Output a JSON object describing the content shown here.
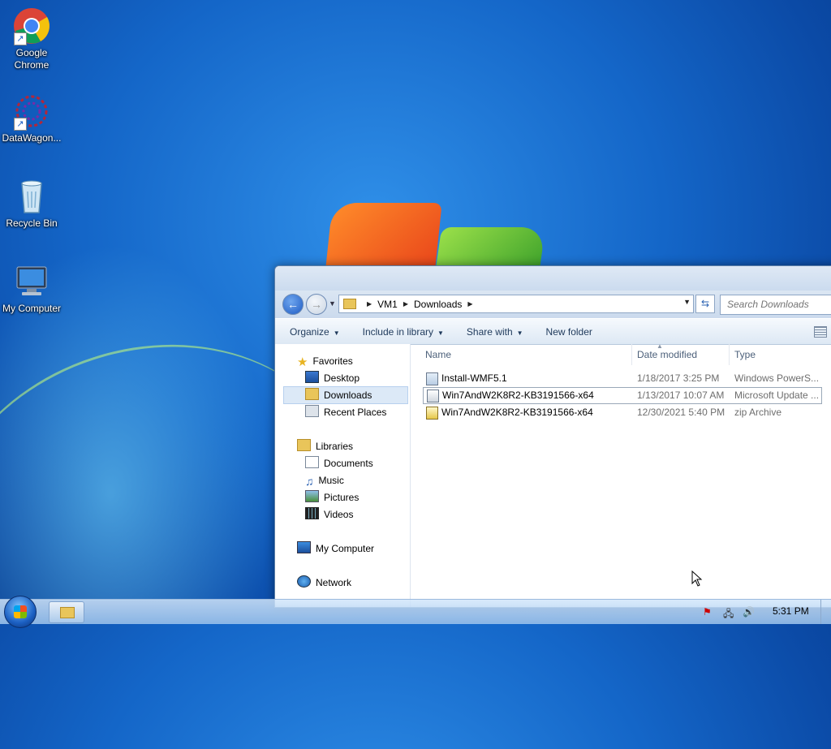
{
  "desktop": {
    "icons": [
      {
        "label": "Google Chrome",
        "icon": "chrome-icon"
      },
      {
        "label": "DataWagon...",
        "icon": "datawagon-icon"
      },
      {
        "label": "Recycle Bin",
        "icon": "recycle-bin-icon"
      },
      {
        "label": "My Computer",
        "icon": "computer-icon"
      }
    ]
  },
  "explorer": {
    "breadcrumb": [
      "VM1",
      "Downloads"
    ],
    "search_placeholder": "Search Downloads",
    "toolbar": {
      "organize": "Organize",
      "include_in_library": "Include in library",
      "share_with": "Share with",
      "new_folder": "New folder"
    },
    "nav": {
      "favorites": "Favorites",
      "desktop": "Desktop",
      "downloads": "Downloads",
      "recent_places": "Recent Places",
      "libraries": "Libraries",
      "documents": "Documents",
      "music": "Music",
      "pictures": "Pictures",
      "videos": "Videos",
      "my_computer": "My Computer",
      "network": "Network"
    },
    "columns": {
      "name": "Name",
      "date_modified": "Date modified",
      "type": "Type"
    },
    "files": [
      {
        "name": "Install-WMF5.1",
        "date": "1/18/2017 3:25 PM",
        "type": "Windows PowerS...",
        "icon": "powershell-script-icon"
      },
      {
        "name": "Win7AndW2K8R2-KB3191566-x64",
        "date": "1/13/2017 10:07 AM",
        "type": "Microsoft Update ...",
        "icon": "update-package-icon"
      },
      {
        "name": "Win7AndW2K8R2-KB3191566-x64",
        "date": "12/30/2021 5:40 PM",
        "type": "zip Archive",
        "icon": "zip-archive-icon"
      }
    ]
  },
  "taskbar": {
    "clock": "5:31 PM"
  },
  "colors": {
    "accent": "#1b5fc2",
    "selection": "#dce9f7"
  }
}
